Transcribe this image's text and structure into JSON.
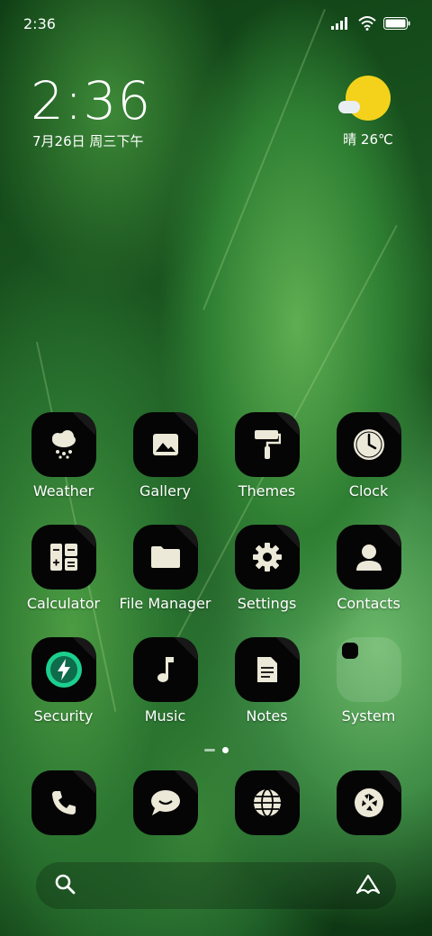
{
  "status_bar": {
    "time": "2:36"
  },
  "clock_widget": {
    "time": "2:36",
    "date": "7月26日 周三下午"
  },
  "weather_widget": {
    "condition_temp": "晴 26℃",
    "sun_color": "#f4d21b"
  },
  "apps": [
    {
      "label": "Weather",
      "icon": "cloud-snow-icon"
    },
    {
      "label": "Gallery",
      "icon": "image-icon"
    },
    {
      "label": "Themes",
      "icon": "paint-roller-icon"
    },
    {
      "label": "Clock",
      "icon": "clock-icon"
    },
    {
      "label": "Calculator",
      "icon": "calculator-icon"
    },
    {
      "label": "File Manager",
      "icon": "folder-icon"
    },
    {
      "label": "Settings",
      "icon": "gear-icon"
    },
    {
      "label": "Contacts",
      "icon": "person-icon"
    },
    {
      "label": "Security",
      "icon": "shield-bolt-icon"
    },
    {
      "label": "Music",
      "icon": "music-note-icon"
    },
    {
      "label": "Notes",
      "icon": "document-icon"
    },
    {
      "label": "System",
      "icon": "folder-icon"
    }
  ],
  "dock": [
    {
      "icon": "phone-icon"
    },
    {
      "icon": "message-icon"
    },
    {
      "icon": "globe-icon"
    },
    {
      "icon": "camera-aperture-icon"
    }
  ],
  "search_bar": {
    "left_icon": "search-icon",
    "right_icon": "assistant-icon"
  },
  "pager": {
    "current_page": 2,
    "total_pages": 2
  }
}
